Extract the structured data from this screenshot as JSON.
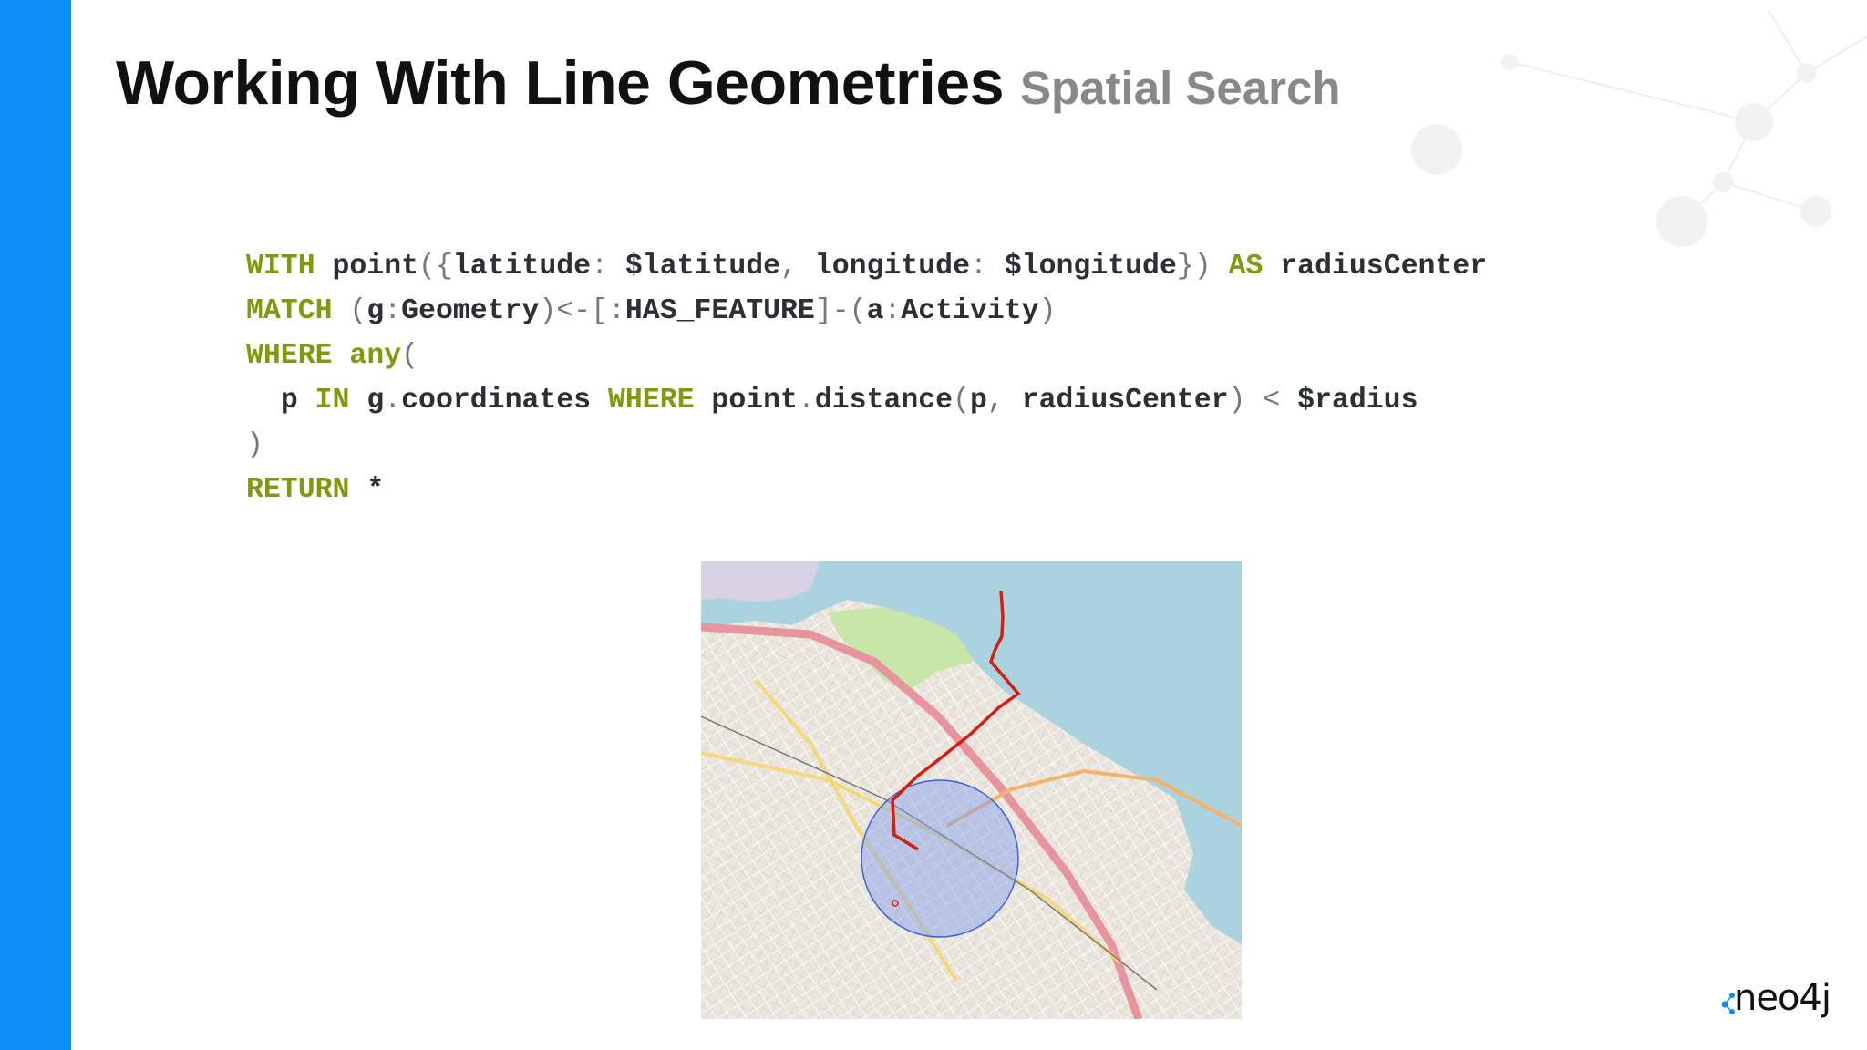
{
  "slide": {
    "title": "Working With Line Geometries",
    "subtitle": "Spatial Search"
  },
  "code": {
    "line1": {
      "k1": "WITH",
      "point": "point",
      "p1": "({",
      "latitude": "latitude",
      "c1": ":",
      "latParam": "$latitude",
      "comma1": ",",
      "longitude": "longitude",
      "c2": ":",
      "lonParam": "$longitude",
      "p2": "})",
      "k2": "AS",
      "alias": "radiusCenter"
    },
    "line2": {
      "k1": "MATCH",
      "p1": "(",
      "g": "g",
      "c1": ":",
      "geom": "Geometry",
      "p2": ")<-[",
      "c2": ":",
      "rel": "HAS_FEATURE",
      "p3": "]-(",
      "a": "a",
      "c3": ":",
      "act": "Activity",
      "p4": ")"
    },
    "line3": {
      "k1": "WHERE",
      "k2": "any",
      "p1": "("
    },
    "line4": {
      "p": "p",
      "k1": "IN",
      "coords": "g",
      "dot1": ".",
      "coords2": "coordinates",
      "k2": "WHERE",
      "fn1": "point",
      "dot2": ".",
      "fn2": "distance",
      "p1": "(",
      "arg1": "p",
      "comma": ",",
      "arg2": "radiusCenter",
      "p2": ")",
      "lt": "<",
      "radius": "$radius"
    },
    "line5": {
      "p1": ")"
    },
    "line6": {
      "k1": "RETURN",
      "star": "*"
    }
  },
  "map": {
    "water_color": "#aad3df",
    "land_color": "#eae5dd",
    "park_color": "#c8e6a8",
    "highway_color": "#e8949e",
    "route_color": "#d61d10",
    "radius_fill": "#7f9cf0",
    "radius_stroke": "#3b62d6"
  },
  "brand": {
    "accent": "#0b8ff5",
    "logo_text": "neo4j"
  }
}
